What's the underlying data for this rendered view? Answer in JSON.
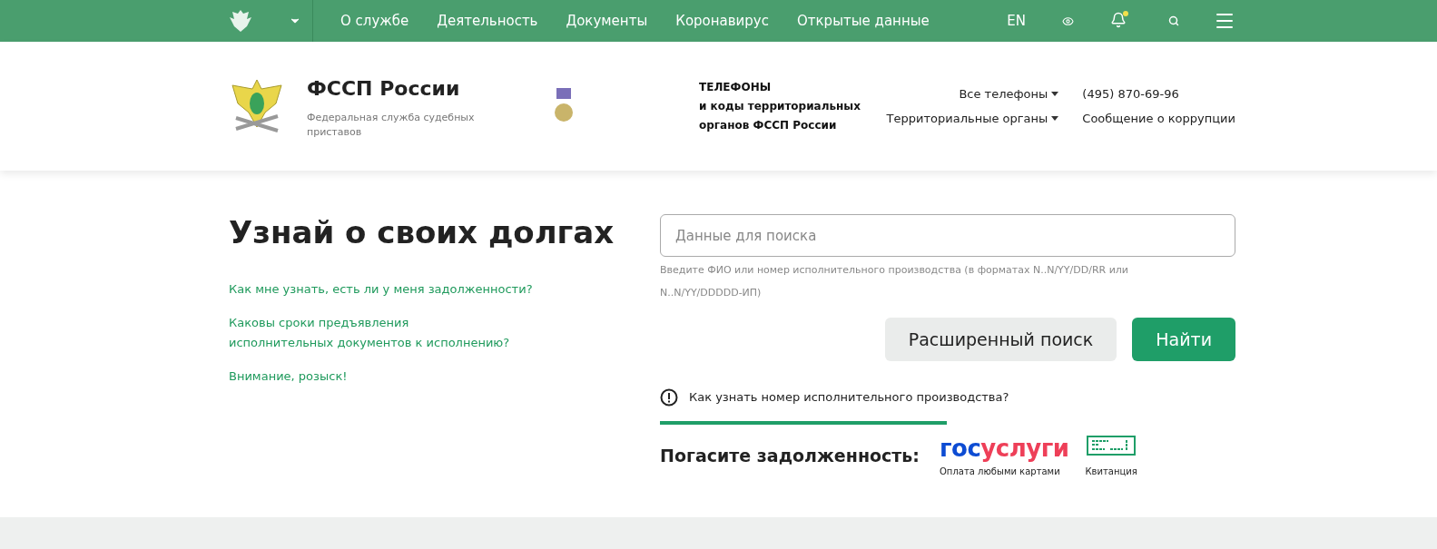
{
  "top_nav": {
    "items": [
      "О службе",
      "Деятельность",
      "Документы",
      "Коронавирус",
      "Открытые данные"
    ],
    "language": "EN"
  },
  "header": {
    "title": "ФССП России",
    "subtitle": "Федеральная служба судебных приставов",
    "phones_heading": [
      "ТЕЛЕФОНЫ",
      "и коды территориальных",
      "органов ФССП России"
    ],
    "dropdowns": [
      "Все телефоны",
      "Территориальные органы"
    ],
    "phone": "(495) 870-69-96",
    "corruption_link": "Сообщение о коррупции"
  },
  "main": {
    "heading": "Узнай о своих долгах",
    "links": [
      [
        "Как мне узнать, есть ли у меня задолженности?"
      ],
      [
        "Каковы сроки предъявления",
        "исполнительных документов к исполнению?"
      ],
      [
        "Внимание, розыск!"
      ]
    ],
    "search": {
      "placeholder": "Данные для поиска",
      "hint": "Введите ФИО или номер исполнительного производства (в форматах N..N/YY/DD/RR или N..N/YY/DDDDD-ИП)"
    },
    "buttons": {
      "advanced": "Расширенный поиск",
      "submit": "Найти"
    },
    "help_link": "Как узнать номер исполнительного производства?",
    "pay": {
      "label": "Погасите задолженность:",
      "gosuslugi_logo": {
        "part_1": "гос",
        "part_2": "услуги"
      },
      "gosuslugi_caption": "Оплата любыми картами",
      "receipt_caption": "Квитанция"
    }
  }
}
